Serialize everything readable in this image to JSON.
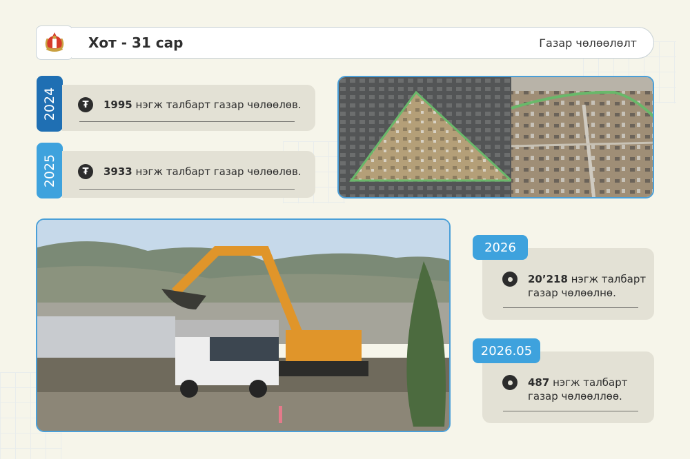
{
  "header": {
    "title": "Хот - 31 сар",
    "right_label": "Газар чөлөөлөлт",
    "logo_icon": "soyombo-emblem-icon"
  },
  "timeline": [
    {
      "year": "2024",
      "number": "1995",
      "text": " нэгж талбарт газар чөлөөлөв.",
      "color": "#1f6fb3",
      "icon": "tugrik-coin-icon"
    },
    {
      "year": "2025",
      "number": "3933",
      "text": " нэгж талбарт газар чөлөөлөв.",
      "color": "#3ea2dd",
      "icon": "tugrik-coin-icon"
    }
  ],
  "plans": [
    {
      "label": "2026",
      "number": "20’218",
      "text_line1": " нэгж талбарт",
      "text_line2": "газар чөлөөлнө.",
      "icon": "location-pin-icon"
    },
    {
      "label": "2026.05",
      "number": "487",
      "text_line1": " нэгж талбарт",
      "text_line2": "газар чөлөөллөө.",
      "icon": "location-pin-icon"
    }
  ],
  "colors": {
    "accent_dark": "#1f6fb3",
    "accent_light": "#3ea2dd",
    "card_bg": "#e3e1d5",
    "page_bg": "#f6f5ea"
  }
}
